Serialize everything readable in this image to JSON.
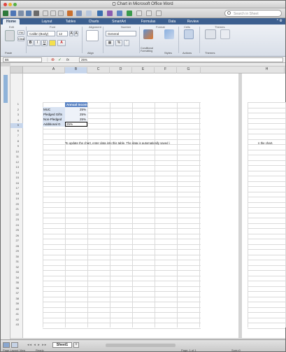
{
  "window": {
    "title": "Chart in Microsoft Office Word"
  },
  "toolbar": {
    "search_placeholder": "Search in Sheet"
  },
  "ribbon_tabs": [
    "Home",
    "Layout",
    "Tables",
    "Charts",
    "SmartArt",
    "Formulas",
    "Data",
    "Review"
  ],
  "ribbon_groups": {
    "edit": "Edit",
    "font": "Font",
    "alignment": "Alignment",
    "number": "Number",
    "format": "Format",
    "cells": "Cells",
    "themes": "Themes"
  },
  "ribbon": {
    "font_name": "Calibri (Body)",
    "font_size": "12",
    "number_format": "General",
    "fill_label": "Fill",
    "clear_label": "Clear",
    "paste_label": "Paste",
    "align_label": "Align",
    "cond_fmt_label": "Conditional Formatting",
    "styles_label": "Styles",
    "actions_label": "Actions",
    "themes_label": "Themes",
    "bold": "B",
    "italic": "I",
    "underline": "U",
    "percent": "%",
    "comma": "’"
  },
  "formula_bar": {
    "cell_ref": "B5",
    "value": "25%"
  },
  "columns": [
    "A",
    "B",
    "C",
    "D",
    "E",
    "F",
    "G",
    "H"
  ],
  "rows": [
    "1",
    "2",
    "3",
    "4",
    "5",
    "6",
    "7",
    "8",
    "9",
    "10",
    "11",
    "12",
    "13",
    "14",
    "15",
    "16",
    "17",
    "18",
    "19",
    "20",
    "21",
    "22",
    "23",
    "24",
    "25",
    "26",
    "27",
    "28",
    "29",
    "30",
    "31",
    "32",
    "33",
    "34",
    "35",
    "36",
    "37",
    "38",
    "39",
    "40",
    "41",
    "42",
    "43"
  ],
  "table": {
    "header": "Annual Incom",
    "rows": [
      {
        "label": "MUC",
        "value": "25%"
      },
      {
        "label": "Pledged Gifts",
        "value": "25%"
      },
      {
        "label": "Non-Pledged",
        "value": "25%"
      },
      {
        "label": "Additional G",
        "value": "25%"
      }
    ]
  },
  "note_text": "To update the chart, enter data into this table. The data is automatically saved i",
  "note_text_cont": "n the chart.",
  "sheet_tab": "Sheet1",
  "status": {
    "view": "Page Layout View",
    "ready": "Ready",
    "page": "Page: 1 of 1",
    "sum": "Sum=0"
  }
}
